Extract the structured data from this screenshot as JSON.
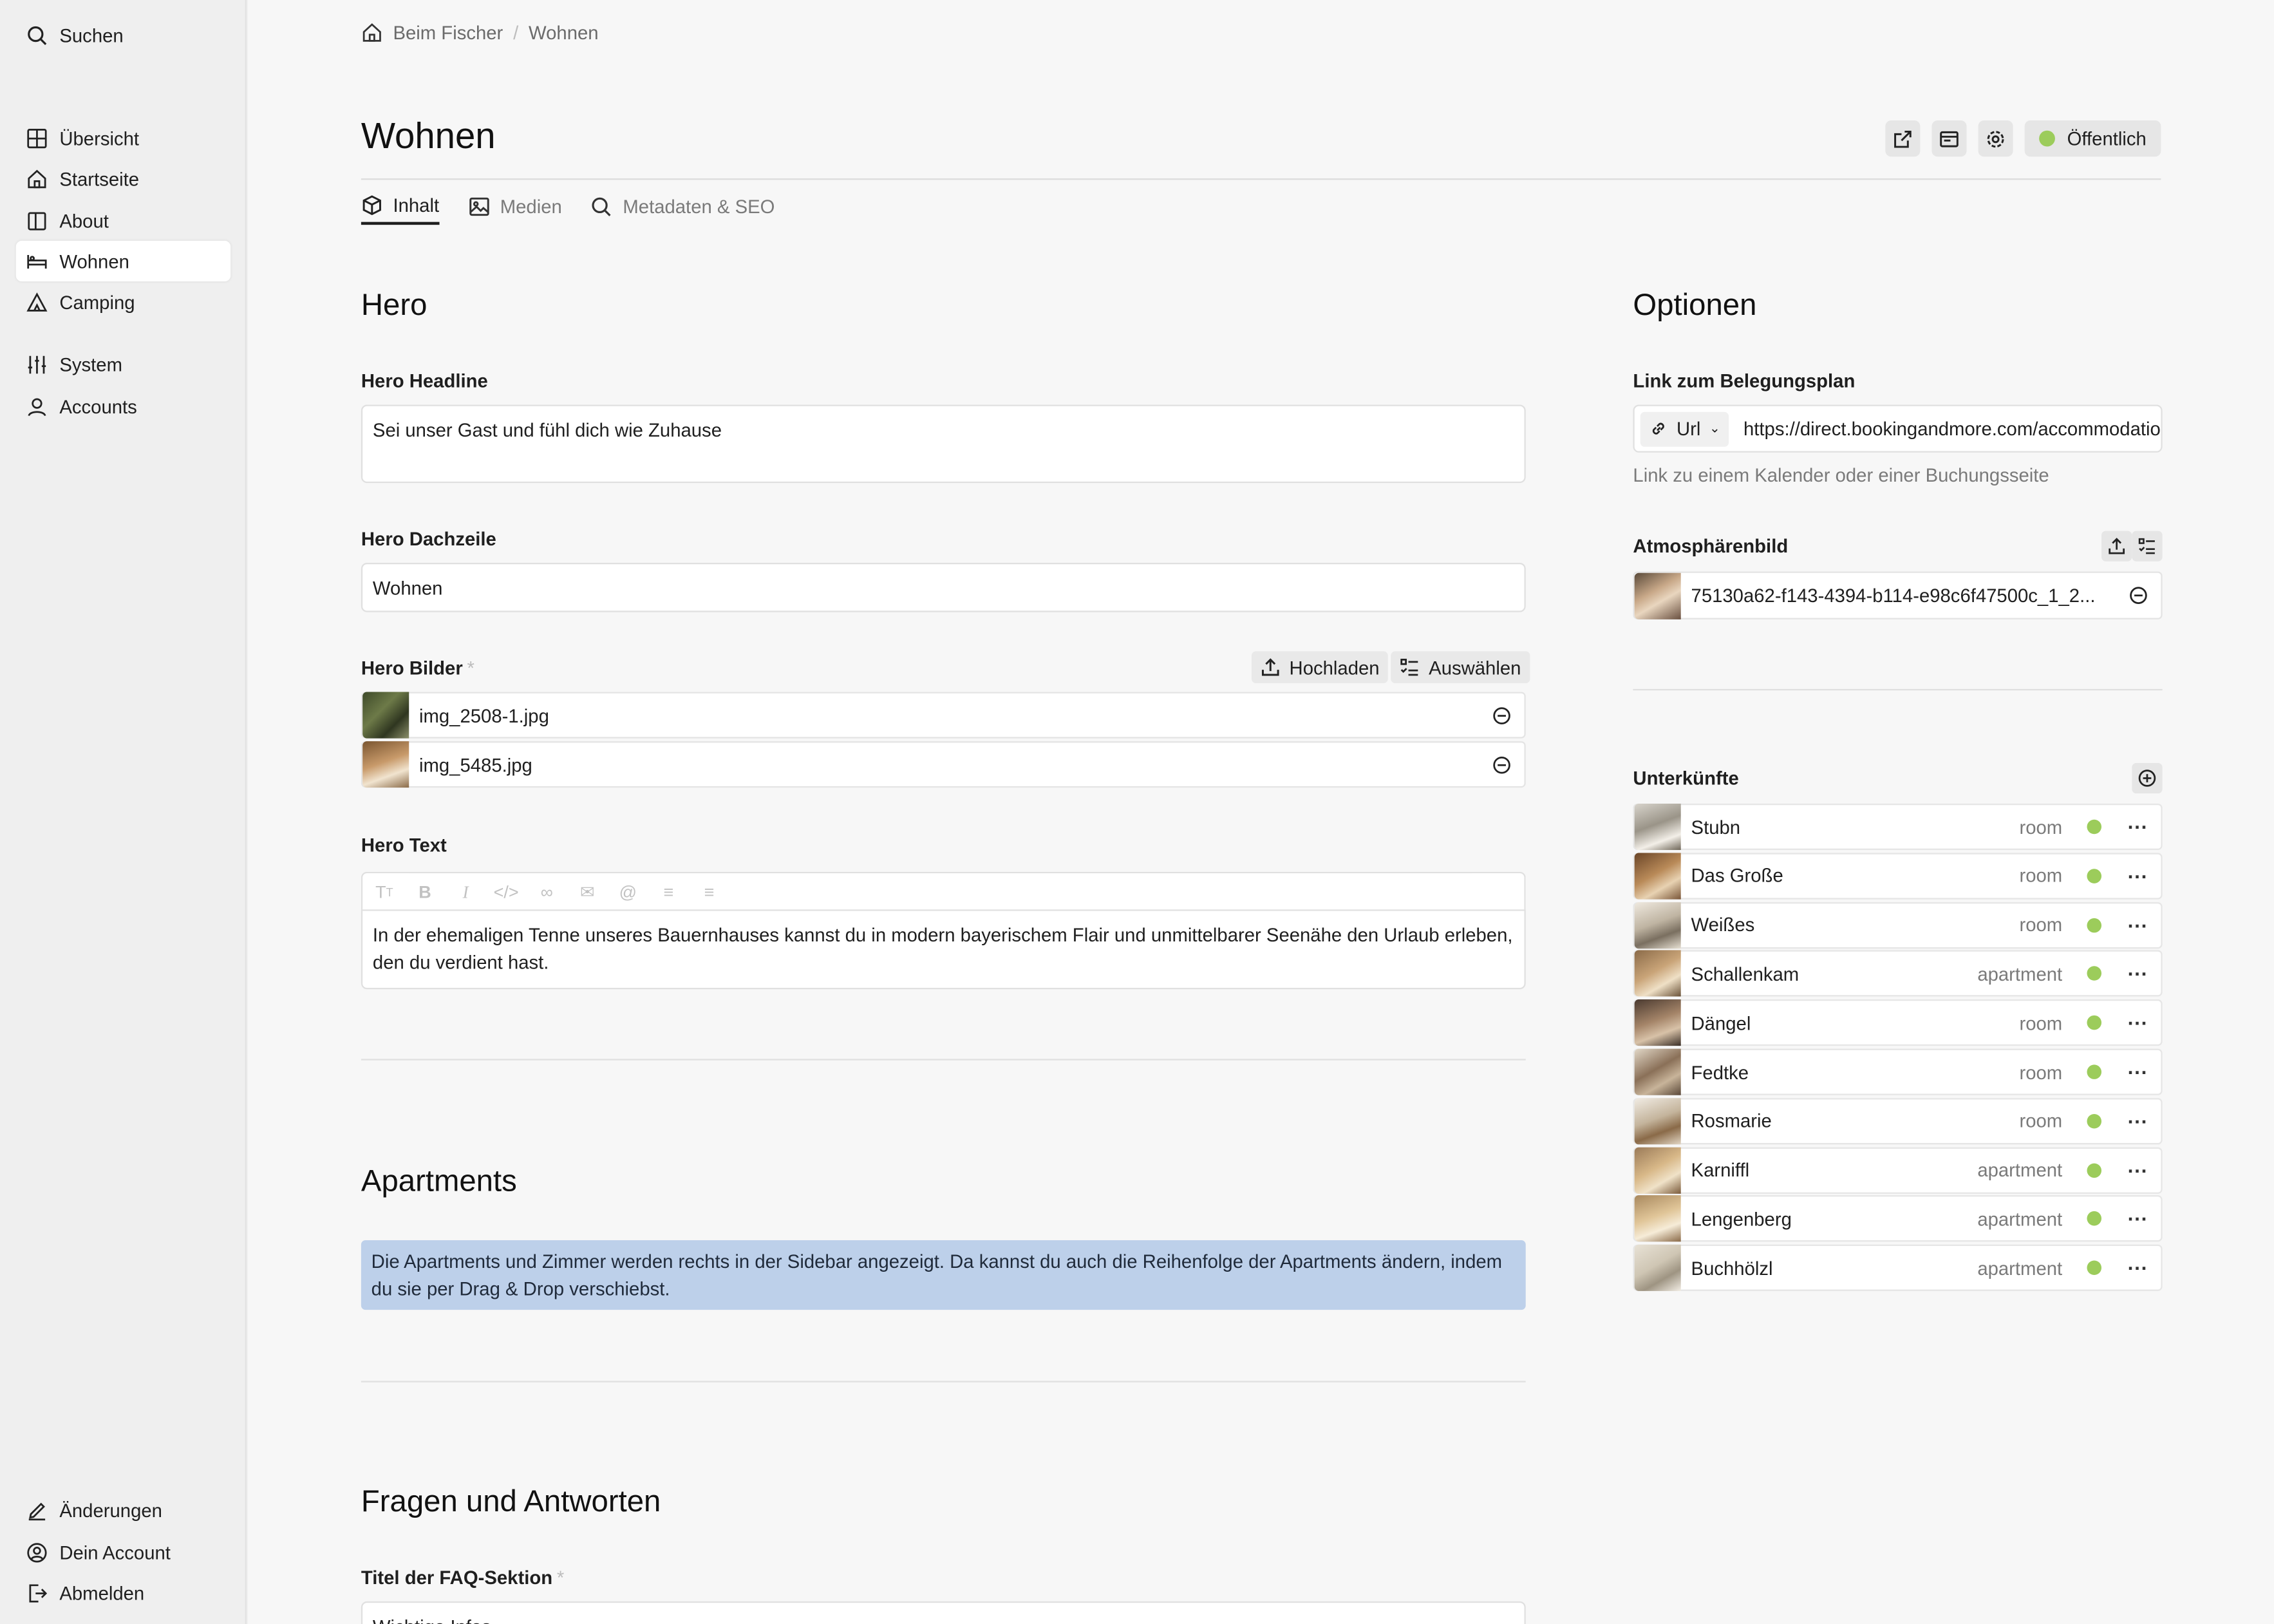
{
  "sidebar": {
    "search": "Suchen",
    "nav": [
      "Übersicht",
      "Startseite",
      "About",
      "Wohnen",
      "Camping"
    ],
    "system": [
      "System",
      "Accounts"
    ],
    "bottom": [
      "Änderungen",
      "Dein Account",
      "Abmelden"
    ]
  },
  "breadcrumb": {
    "home": "Beim Fischer",
    "separator": "/",
    "current": "Wohnen"
  },
  "page": {
    "title": "Wohnen",
    "status": "Öffentlich",
    "status_color": "#9ccc5b"
  },
  "tabs": [
    "Inhalt",
    "Medien",
    "Metadaten & SEO"
  ],
  "hero": {
    "heading": "Hero",
    "headline_label": "Hero Headline",
    "headline_value": "Sei unser Gast und fühl dich wie Zuhause",
    "dachzeile_label": "Hero Dachzeile",
    "dachzeile_value": "Wohnen",
    "bilder_label": "Hero Bilder",
    "required_mark": "*",
    "upload": "Hochladen",
    "select": "Auswählen",
    "files": [
      "img_2508-1.jpg",
      "img_5485.jpg"
    ],
    "text_label": "Hero Text",
    "text_value": "In der ehemaligen Tenne unseres Bauernhauses kannst du in modern bayerischem Flair und unmittelbarer Seenähe den Urlaub erleben, den du verdient hast."
  },
  "apartments": {
    "heading": "Apartments",
    "info": "Die Apartments und Zimmer werden rechts in der Sidebar angezeigt. Da kannst du auch die Reihenfolge der Apartments ändern, indem du sie per Drag & Drop verschiebst."
  },
  "faq": {
    "heading": "Fragen und Antworten",
    "title_label": "Titel der FAQ-Sektion",
    "required_mark": "*",
    "title_value": "Wichtige Infos"
  },
  "options": {
    "heading": "Optionen",
    "link_label": "Link zum Belegungsplan",
    "link_type": "Url",
    "link_value": "https://direct.bookingandmore.com/accommodation",
    "link_hint": "Link zu einem Kalender oder einer Buchungsseite",
    "image_label": "Atmosphärenbild",
    "image_value": "75130a62-f143-4394-b114-e98c6f47500c_1_2..."
  },
  "accommodations": {
    "heading": "Unterkünfte",
    "items": [
      {
        "name": "Stubn",
        "type": "room"
      },
      {
        "name": "Das Große",
        "type": "room"
      },
      {
        "name": "Weißes",
        "type": "room"
      },
      {
        "name": "Schallenkam",
        "type": "apartment"
      },
      {
        "name": "Dängel",
        "type": "room"
      },
      {
        "name": "Fedtke",
        "type": "room"
      },
      {
        "name": "Rosmarie",
        "type": "room"
      },
      {
        "name": "Karniffl",
        "type": "apartment"
      },
      {
        "name": "Lengenberg",
        "type": "apartment"
      },
      {
        "name": "Buchhölzl",
        "type": "apartment"
      }
    ]
  },
  "toolbar_icons": [
    "text-size-icon",
    "bold-icon",
    "italic-icon",
    "code-icon",
    "link-icon",
    "mail-icon",
    "attachment-icon",
    "bullet-list-icon",
    "ordered-list-icon"
  ]
}
